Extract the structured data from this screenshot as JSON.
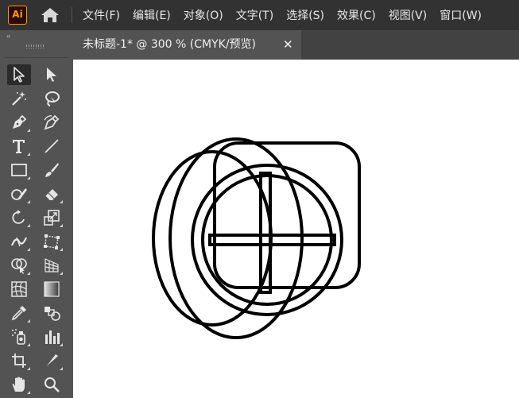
{
  "app": {
    "logo_text": "Ai"
  },
  "menu": {
    "items": [
      "文件(F)",
      "编辑(E)",
      "对象(O)",
      "文字(T)",
      "选择(S)",
      "效果(C)",
      "视图(V)",
      "窗口(W)"
    ]
  },
  "document_tab": {
    "title": "未标题-1* @ 300 % (CMYK/预览)",
    "close_glyph": "✕"
  },
  "toolbar": {
    "collapse_glyph": "‹‹",
    "tools": [
      {
        "name": "selection-tool",
        "icon": "arrow-outline-icon",
        "active": true
      },
      {
        "name": "direct-selection-tool",
        "icon": "arrow-filled-icon"
      },
      {
        "name": "magic-wand-tool",
        "icon": "magic-wand-icon"
      },
      {
        "name": "lasso-tool",
        "icon": "lasso-icon"
      },
      {
        "name": "pen-tool",
        "icon": "pen-icon"
      },
      {
        "name": "curvature-tool",
        "icon": "curvature-pen-icon"
      },
      {
        "name": "type-tool",
        "icon": "type-icon"
      },
      {
        "name": "line-segment-tool",
        "icon": "line-icon"
      },
      {
        "name": "rectangle-tool",
        "icon": "rectangle-icon"
      },
      {
        "name": "paintbrush-tool",
        "icon": "brush-icon"
      },
      {
        "name": "shaper-tool",
        "icon": "shaper-icon"
      },
      {
        "name": "eraser-tool",
        "icon": "eraser-icon"
      },
      {
        "name": "rotate-tool",
        "icon": "rotate-icon"
      },
      {
        "name": "scale-tool",
        "icon": "scale-icon"
      },
      {
        "name": "width-tool",
        "icon": "width-icon"
      },
      {
        "name": "free-transform-tool",
        "icon": "free-transform-icon"
      },
      {
        "name": "shape-builder-tool",
        "icon": "shape-builder-icon"
      },
      {
        "name": "perspective-grid-tool",
        "icon": "perspective-grid-icon"
      },
      {
        "name": "mesh-tool",
        "icon": "mesh-icon"
      },
      {
        "name": "gradient-tool",
        "icon": "gradient-icon"
      },
      {
        "name": "eyedropper-tool",
        "icon": "eyedropper-icon"
      },
      {
        "name": "blend-tool",
        "icon": "blend-icon"
      },
      {
        "name": "symbol-sprayer-tool",
        "icon": "symbol-sprayer-icon"
      },
      {
        "name": "column-graph-tool",
        "icon": "column-graph-icon"
      },
      {
        "name": "artboard-tool",
        "icon": "artboard-icon"
      },
      {
        "name": "slice-tool",
        "icon": "slice-icon"
      },
      {
        "name": "hand-tool",
        "icon": "hand-icon"
      },
      {
        "name": "zoom-tool",
        "icon": "zoom-icon"
      }
    ]
  },
  "canvas": {
    "background": "#ffffff",
    "stroke_color": "#000000"
  },
  "colors": {
    "menubar": "#323232",
    "panel": "#535353",
    "logo_accent": "#ff9a00"
  }
}
